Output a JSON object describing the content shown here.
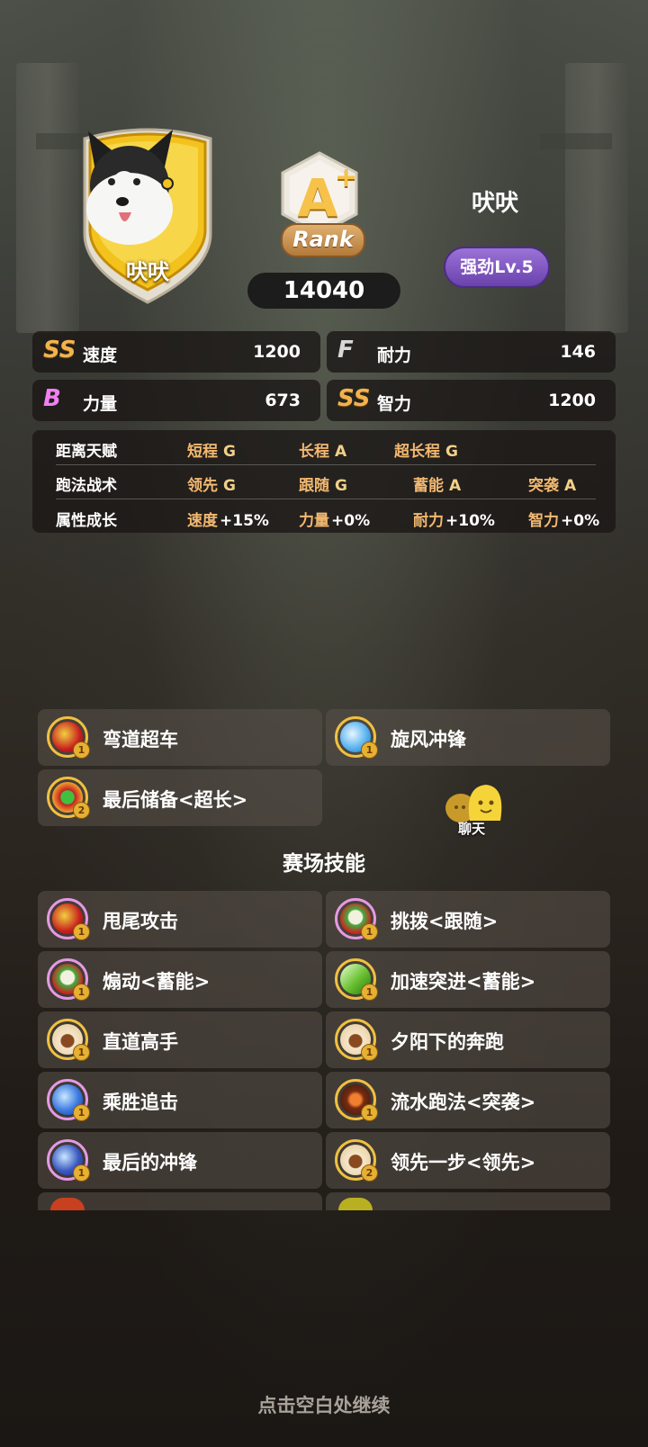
{
  "horse": {
    "badge_name": "吠吠",
    "name": "吠吠",
    "rank_letter": "A",
    "rank_plus": "+",
    "rank_label": "Rank",
    "score": "14040",
    "level": "强劲Lv.5"
  },
  "stats": [
    {
      "grade": "SS",
      "label": "速度",
      "value": "1200"
    },
    {
      "grade": "F",
      "label": "耐力",
      "value": "146"
    },
    {
      "grade": "B",
      "label": "力量",
      "value": "673"
    },
    {
      "grade": "SS",
      "label": "智力",
      "value": "1200"
    }
  ],
  "talents": {
    "distance": {
      "header": "距离天赋",
      "items": [
        {
          "label": "短程",
          "grade": "G"
        },
        {
          "label": "长程",
          "grade": "A"
        },
        {
          "label": "超长程",
          "grade": "G"
        }
      ]
    },
    "strategy": {
      "header": "跑法战术",
      "items": [
        {
          "label": "领先",
          "grade": "G"
        },
        {
          "label": "跟随",
          "grade": "G"
        },
        {
          "label": "蓄能",
          "grade": "A"
        },
        {
          "label": "突袭",
          "grade": "A"
        }
      ]
    },
    "growth": {
      "header": "属性成长",
      "items": [
        {
          "label": "速度",
          "grade": "+15%"
        },
        {
          "label": "力量",
          "grade": "+0%"
        },
        {
          "label": "耐力",
          "grade": "+10%"
        },
        {
          "label": "智力",
          "grade": "+0%"
        }
      ]
    }
  },
  "unique_skills": [
    {
      "name": "弯道超车",
      "level": "1",
      "icon": "swoosh-red-icon"
    },
    {
      "name": "旋风冲锋",
      "level": "1",
      "icon": "wind-blue-icon"
    },
    {
      "name": "最后储备<超长>",
      "level": "2",
      "icon": "plus-green-icon"
    }
  ],
  "chat": {
    "label": "聊天"
  },
  "section_title": "赛场技能",
  "field_skills": [
    {
      "name": "甩尾攻击",
      "level": "1",
      "icon": "swoosh-red-icon"
    },
    {
      "name": "挑拨<跟随>",
      "level": "1",
      "icon": "clown-icon"
    },
    {
      "name": "煽动<蓄能>",
      "level": "1",
      "icon": "clown-icon"
    },
    {
      "name": "加速突进<蓄能>",
      "level": "1",
      "icon": "arrow-green-icon"
    },
    {
      "name": "直道高手",
      "level": "1",
      "icon": "dino-icon"
    },
    {
      "name": "夕阳下的奔跑",
      "level": "1",
      "icon": "dino-icon"
    },
    {
      "name": "乘胜追击",
      "level": "1",
      "icon": "lightning-blue-icon"
    },
    {
      "name": "流水跑法<突袭>",
      "level": "1",
      "icon": "flame-dark-icon"
    },
    {
      "name": "最后的冲锋",
      "level": "1",
      "icon": "lightning-blue-icon"
    },
    {
      "name": "领先一步<领先>",
      "level": "2",
      "icon": "dino-icon"
    }
  ],
  "footer": {
    "continue": "点击空白处继续"
  }
}
